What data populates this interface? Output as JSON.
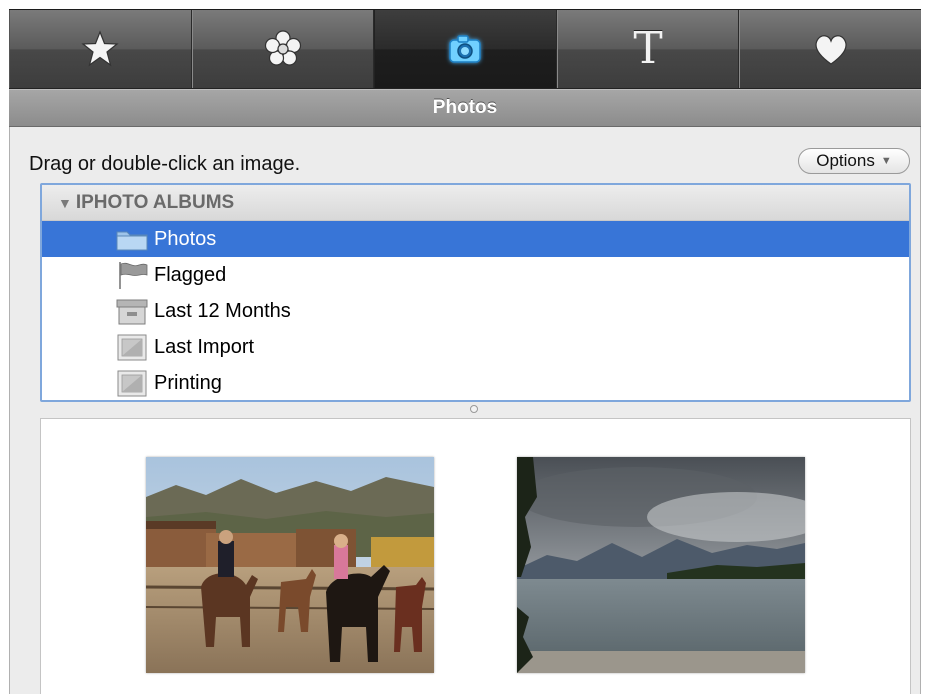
{
  "tabs": [
    {
      "name": "star",
      "icon": "star-icon"
    },
    {
      "name": "flower",
      "icon": "flower-icon"
    },
    {
      "name": "camera",
      "icon": "camera-icon",
      "active": true
    },
    {
      "name": "text",
      "icon": "text-icon",
      "glyph": "T"
    },
    {
      "name": "heart",
      "icon": "heart-icon"
    }
  ],
  "header": {
    "title": "Photos"
  },
  "instructions": "Drag or double-click an image.",
  "options_button": {
    "label": "Options",
    "caret": "▼"
  },
  "source_list": {
    "section": {
      "label": "IPHOTO ALBUMS",
      "expanded_glyph": "▼"
    },
    "items": [
      {
        "label": "Photos",
        "icon": "folder-icon",
        "selected": true
      },
      {
        "label": "Flagged",
        "icon": "flag-icon",
        "selected": false
      },
      {
        "label": "Last 12 Months",
        "icon": "archive-box-icon",
        "selected": false
      },
      {
        "label": "Last Import",
        "icon": "photo-album-icon",
        "selected": false
      },
      {
        "label": "Printing",
        "icon": "photo-album-icon",
        "selected": false
      }
    ]
  },
  "thumbnails": [
    {
      "name": "horses-mountain-photo",
      "description_icon": "photo-thumbnail"
    },
    {
      "name": "lake-mountain-photo",
      "description_icon": "photo-thumbnail"
    }
  ],
  "colors": {
    "selection": "#3875d7",
    "focus_ring": "#7fa7dc",
    "camera_glow": "#3ab6f0"
  }
}
